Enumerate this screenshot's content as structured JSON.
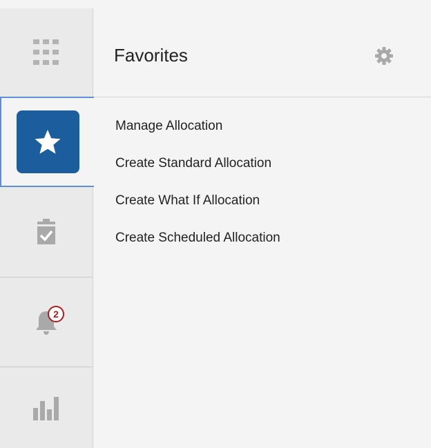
{
  "rail": {
    "items": [
      {
        "name": "apps",
        "icon": "apps-grid-icon"
      },
      {
        "name": "favorites",
        "icon": "star-icon",
        "selected": true
      },
      {
        "name": "tasks",
        "icon": "clipboard-check-icon"
      },
      {
        "name": "notifications",
        "icon": "bell-icon",
        "badge": "2"
      },
      {
        "name": "reports",
        "icon": "bar-chart-icon"
      }
    ],
    "notification_badge": "2"
  },
  "panel": {
    "title": "Favorites",
    "settings_icon": "gear-icon",
    "items": [
      {
        "label": "Manage Allocation"
      },
      {
        "label": "Create Standard Allocation"
      },
      {
        "label": "Create What If Allocation"
      },
      {
        "label": "Create Scheduled Allocation"
      }
    ]
  },
  "colors": {
    "accent": "#1c5d9e",
    "selection_border": "#5b8fd8",
    "icon_gray": "#a9a9a9",
    "badge_red": "#b31b1b",
    "rail_background": "#eaeaea",
    "panel_background": "#f4f4f4"
  }
}
